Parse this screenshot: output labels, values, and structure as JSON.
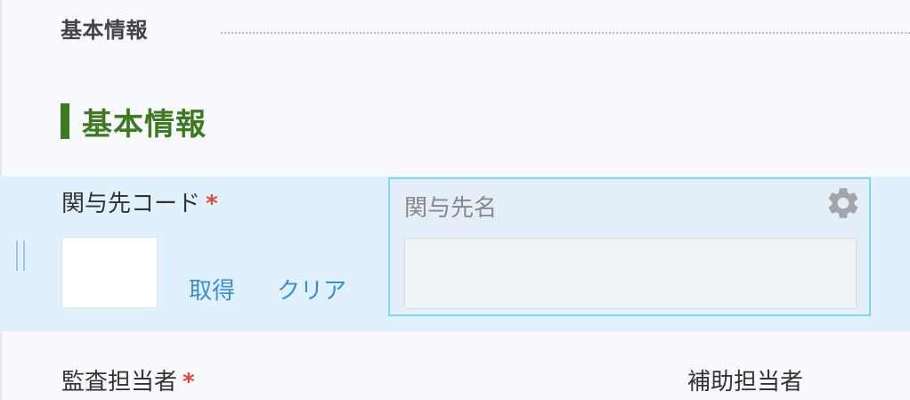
{
  "section": {
    "header": "基本情報",
    "heading": "基本情報"
  },
  "row1": {
    "code_label": "関与先コード",
    "required_mark": "*",
    "get_link": "取得",
    "clear_link": "クリア",
    "name_label": "関与先名",
    "code_value": "",
    "name_value": ""
  },
  "row2": {
    "auditor_label": "監査担当者",
    "required_mark": "*",
    "assistant_label": "補助担当者"
  },
  "icons": {
    "settings": "gear-icon",
    "drag": "drag-handle-icon"
  },
  "colors": {
    "heading_green": "#3f7a22",
    "required_red": "#e0473a",
    "link_blue": "#3a8fd4",
    "row_highlight": "#e1f0fd",
    "focus_border": "#7fd8f3"
  }
}
